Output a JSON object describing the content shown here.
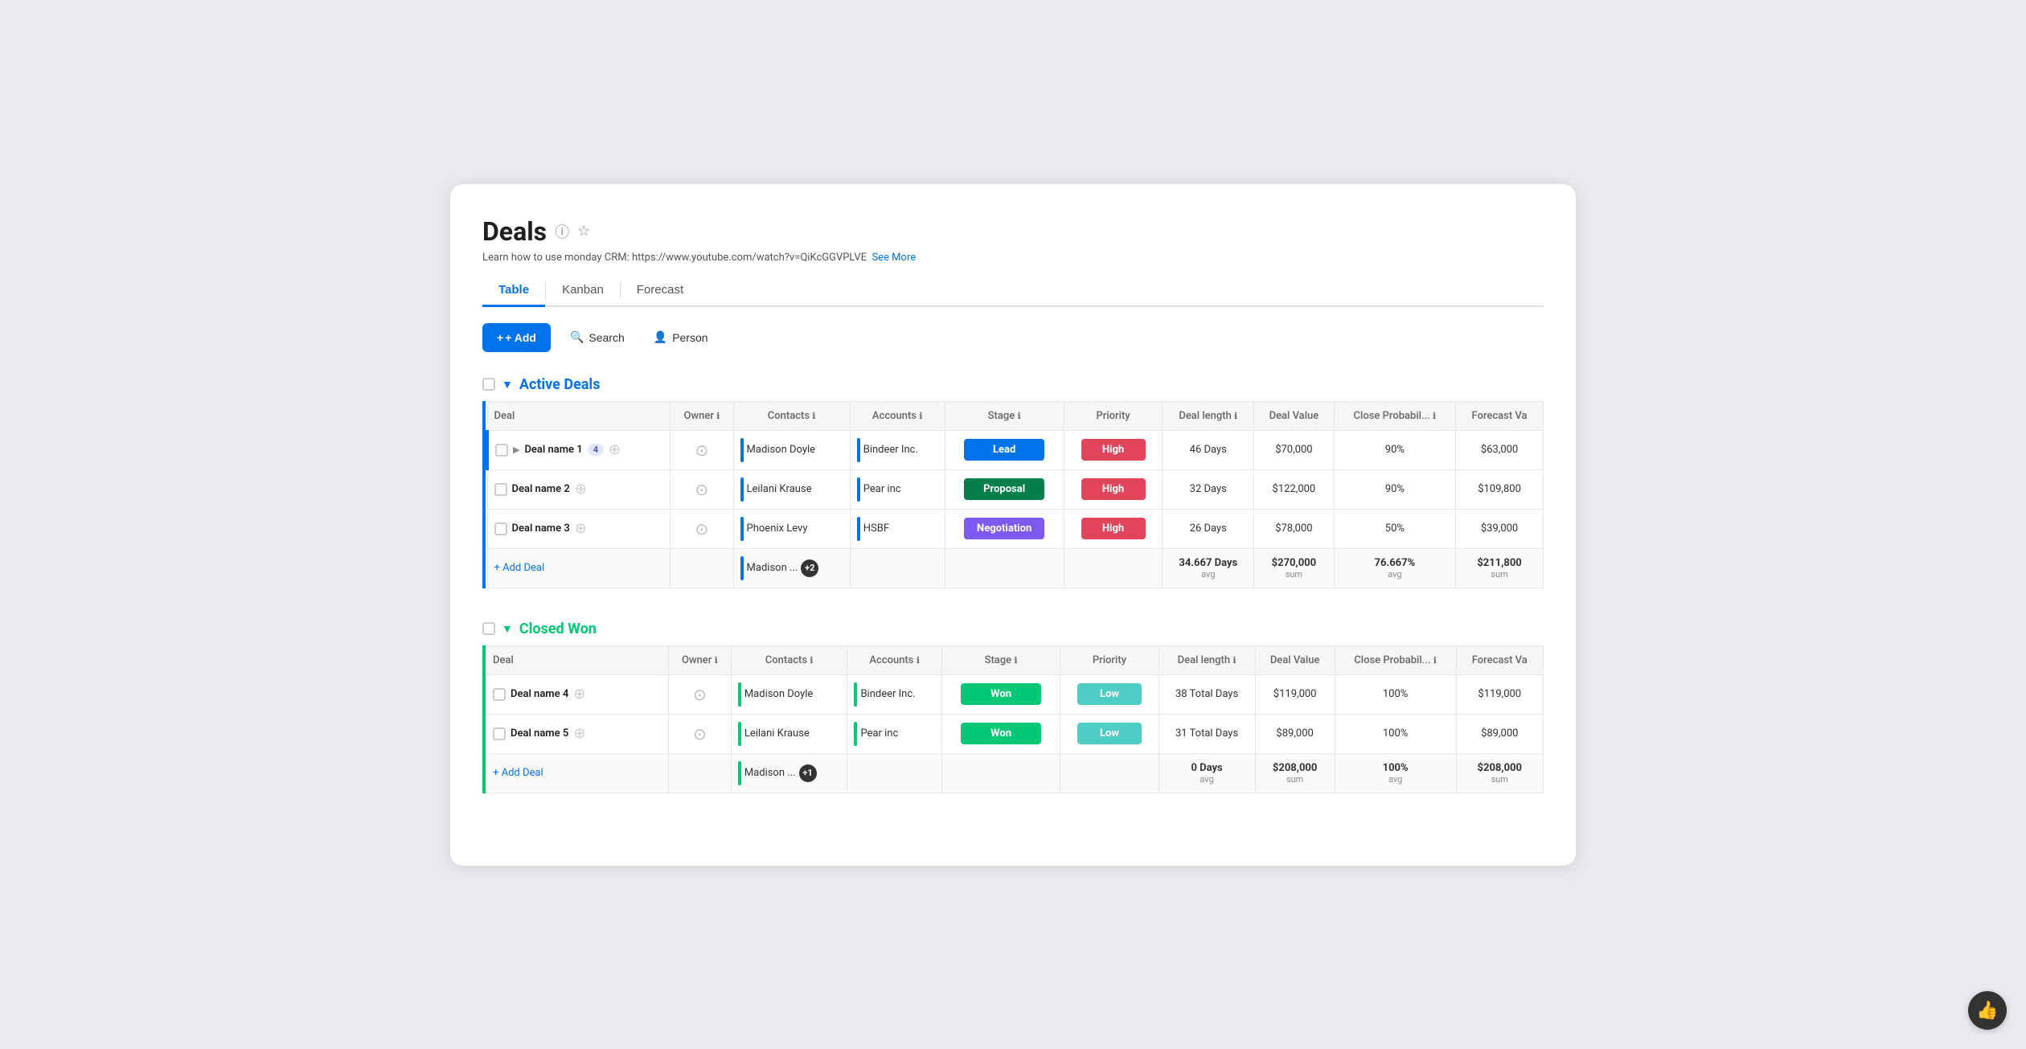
{
  "page": {
    "title": "Deals",
    "subtitle": "Learn how to use monday CRM: https://www.youtube.com/watch?v=QiKcGGVPLVE",
    "see_more": "See More"
  },
  "tabs": [
    {
      "label": "Table",
      "active": true
    },
    {
      "label": "Kanban",
      "active": false
    },
    {
      "label": "Forecast",
      "active": false
    }
  ],
  "toolbar": {
    "add_label": "+ Add",
    "search_label": "Search",
    "person_label": "Person"
  },
  "active_deals": {
    "section_title": "Active Deals",
    "headers": [
      "Deal",
      "Owner",
      "Contacts",
      "Accounts",
      "Stage",
      "Priority",
      "Deal length",
      "Deal Value",
      "Close Probabil...",
      "Forecast Va"
    ],
    "rows": [
      {
        "name": "Deal name 1",
        "count": 4,
        "has_expand": true,
        "contacts": "Madison Doyle",
        "accounts": "Bindeer Inc.",
        "stage": "Lead",
        "stage_class": "stage-lead",
        "priority": "High",
        "priority_class": "priority-high",
        "deal_length": "46 Days",
        "deal_value": "$70,000",
        "close_prob": "90%",
        "forecast_val": "$63,000"
      },
      {
        "name": "Deal name 2",
        "count": null,
        "has_expand": false,
        "contacts": "Leilani Krause",
        "accounts": "Pear inc",
        "stage": "Proposal",
        "stage_class": "stage-proposal",
        "priority": "High",
        "priority_class": "priority-high",
        "deal_length": "32 Days",
        "deal_value": "$122,000",
        "close_prob": "90%",
        "forecast_val": "$109,800"
      },
      {
        "name": "Deal name 3",
        "count": null,
        "has_expand": false,
        "contacts": "Phoenix Levy",
        "accounts": "HSBF",
        "stage": "Negotiation",
        "stage_class": "stage-negotiation",
        "priority": "High",
        "priority_class": "priority-high",
        "deal_length": "26 Days",
        "deal_value": "$78,000",
        "close_prob": "50%",
        "forecast_val": "$39,000"
      }
    ],
    "summary": {
      "contacts": "Madison ...",
      "contacts_badge": "+2",
      "deal_length_val": "34.667 Days",
      "deal_length_lbl": "avg",
      "deal_value_val": "$270,000",
      "deal_value_lbl": "sum",
      "close_prob_val": "76.667%",
      "close_prob_lbl": "avg",
      "forecast_val_val": "$211,800",
      "forecast_val_lbl": "sum"
    }
  },
  "closed_won": {
    "section_title": "Closed Won",
    "headers": [
      "Deal",
      "Owner",
      "Contacts",
      "Accounts",
      "Stage",
      "Priority",
      "Deal length",
      "Deal Value",
      "Close Probabil...",
      "Forecast Va"
    ],
    "rows": [
      {
        "name": "Deal name 4",
        "count": null,
        "has_expand": false,
        "contacts": "Madison Doyle",
        "accounts": "Bindeer Inc.",
        "stage": "Won",
        "stage_class": "stage-won",
        "priority": "Low",
        "priority_class": "priority-low",
        "deal_length": "38 Total Days",
        "deal_value": "$119,000",
        "close_prob": "100%",
        "forecast_val": "$119,000"
      },
      {
        "name": "Deal name 5",
        "count": null,
        "has_expand": false,
        "contacts": "Leilani Krause",
        "accounts": "Pear inc",
        "stage": "Won",
        "stage_class": "stage-won",
        "priority": "Low",
        "priority_class": "priority-low",
        "deal_length": "31 Total Days",
        "deal_value": "$89,000",
        "close_prob": "100%",
        "forecast_val": "$89,000"
      }
    ],
    "summary": {
      "contacts": "Madison ...",
      "contacts_badge": "+1",
      "deal_length_val": "0 Days",
      "deal_length_lbl": "avg",
      "deal_value_val": "$208,000",
      "deal_value_lbl": "sum",
      "close_prob_val": "100%",
      "close_prob_lbl": "avg",
      "forecast_val_val": "$208,000",
      "forecast_val_lbl": "sum"
    }
  },
  "colors": {
    "brand_blue": "#0073ea",
    "won_green": "#00c875",
    "high_red": "#e2445c",
    "low_teal": "#4ecdc4"
  }
}
